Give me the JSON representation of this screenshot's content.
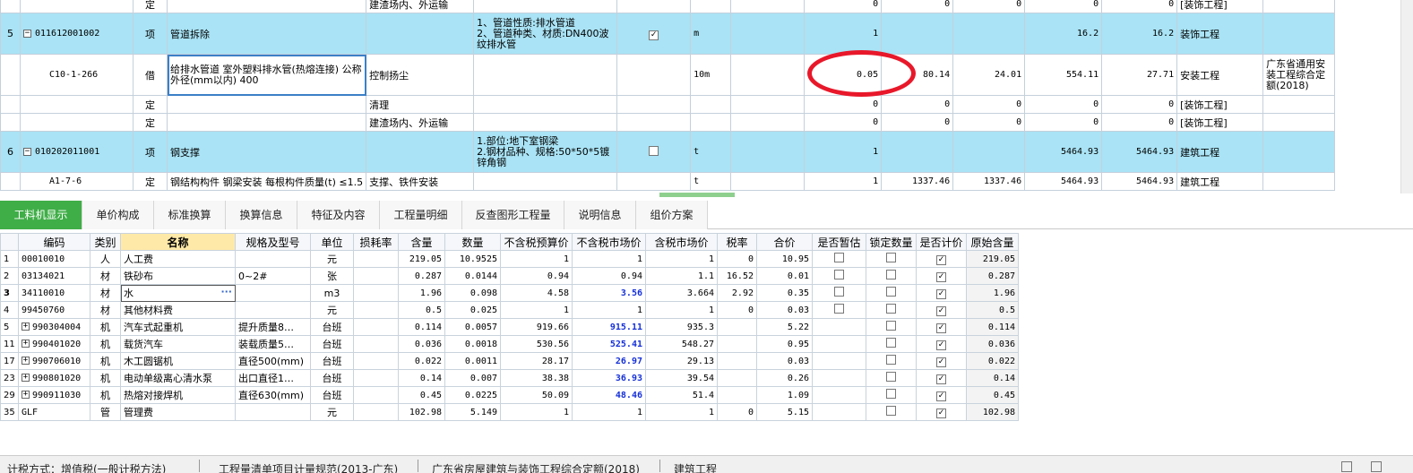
{
  "top_rows": [
    {
      "type": "child",
      "no": "",
      "code": "",
      "kind": "定",
      "name": "",
      "desc": "建渣场内、外运输",
      "feature": "",
      "check": "",
      "unit": "",
      "v1": "0",
      "v2": "0",
      "v3": "0",
      "v4": "0",
      "v5": "0",
      "cat": "[装饰工程]",
      "std": ""
    },
    {
      "type": "blue",
      "no": "5",
      "code": "011612001002",
      "kind": "项",
      "name": "管道拆除",
      "desc": "",
      "feature": "1、管道性质:排水管道\n2、管道种类、材质:DN400波纹排水管",
      "check": "checked",
      "unit": "m",
      "v1": "1",
      "v2": "",
      "v3": "",
      "v4": "16.2",
      "v5": "16.2",
      "cat": "装饰工程",
      "std": ""
    },
    {
      "type": "tall",
      "no": "",
      "code": "C10-1-266",
      "kind": "借",
      "name": "给排水管道 室外塑料排水管(热熔连接) 公称外径(mm以内) 400",
      "desc": "控制扬尘",
      "feature": "",
      "check": "",
      "unit": "10m",
      "v1": "0.05",
      "v2": "80.14",
      "v3": "24.01",
      "v4": "554.11",
      "v5": "27.71",
      "cat": "安装工程",
      "std": "广东省通用安装工程综合定额(2018)"
    },
    {
      "type": "child",
      "no": "",
      "code": "",
      "kind": "定",
      "name": "",
      "desc": "清理",
      "feature": "",
      "check": "",
      "unit": "",
      "v1": "0",
      "v2": "0",
      "v3": "0",
      "v4": "0",
      "v5": "0",
      "cat": "[装饰工程]",
      "std": ""
    },
    {
      "type": "child",
      "no": "",
      "code": "",
      "kind": "定",
      "name": "",
      "desc": "建渣场内、外运输",
      "feature": "",
      "check": "",
      "unit": "",
      "v1": "0",
      "v2": "0",
      "v3": "0",
      "v4": "0",
      "v5": "0",
      "cat": "[装饰工程]",
      "std": ""
    },
    {
      "type": "blue",
      "no": "6",
      "code": "010202011001",
      "kind": "项",
      "name": "钢支撑",
      "desc": "",
      "feature": "1.部位:地下室钢梁\n2.钢材品种、规格:50*50*5镀锌角钢",
      "check": "unchecked",
      "unit": "t",
      "v1": "1",
      "v2": "",
      "v3": "",
      "v4": "5464.93",
      "v5": "5464.93",
      "cat": "建筑工程",
      "std": ""
    },
    {
      "type": "child",
      "no": "",
      "code": "A1-7-6",
      "kind": "定",
      "name": "钢结构构件 钢梁安装 每根构件质量(t) ≤1.5",
      "desc": "支撑、铁件安装",
      "feature": "",
      "check": "",
      "unit": "t",
      "v1": "1",
      "v2": "1337.46",
      "v3": "1337.46",
      "v4": "5464.93",
      "v5": "5464.93",
      "cat": "建筑工程",
      "std": ""
    }
  ],
  "tabs": [
    "工料机显示",
    "单价构成",
    "标准换算",
    "换算信息",
    "特征及内容",
    "工程量明细",
    "反查图形工程量",
    "说明信息",
    "组价方案"
  ],
  "grid_headers": [
    "编码",
    "类别",
    "名称",
    "规格及型号",
    "单位",
    "损耗率",
    "含量",
    "数量",
    "不含税预算价",
    "不含税市场价",
    "含税市场价",
    "税率",
    "合价",
    "是否暂估",
    "锁定数量",
    "是否计价",
    "原始含量"
  ],
  "grid_rows": [
    {
      "no": "1",
      "code": "00010010",
      "type": "人",
      "name": "人工费",
      "spec": "",
      "unit": "元",
      "loss": "",
      "qty_ratio": "219.05",
      "qty": "10.9525",
      "pre_tax_budget": "1",
      "pre_tax_market": "1",
      "tax_market": "1",
      "tax_rate": "0",
      "total": "10.95",
      "est": "unchecked",
      "lock": "unchecked",
      "priced": "checked",
      "orig": "219.05",
      "expand": false,
      "blue": false
    },
    {
      "no": "2",
      "code": "03134021",
      "type": "材",
      "name": "铁砂布",
      "spec": "0~2#",
      "unit": "张",
      "loss": "",
      "qty_ratio": "0.287",
      "qty": "0.0144",
      "pre_tax_budget": "0.94",
      "pre_tax_market": "0.94",
      "tax_market": "1.1",
      "tax_rate": "16.52",
      "total": "0.01",
      "est": "unchecked",
      "lock": "unchecked",
      "priced": "checked",
      "orig": "0.287",
      "expand": false,
      "blue": false
    },
    {
      "no": "3",
      "code": "34110010",
      "type": "材",
      "name": "水",
      "spec": "",
      "unit": "m3",
      "loss": "",
      "qty_ratio": "1.96",
      "qty": "0.098",
      "pre_tax_budget": "4.58",
      "pre_tax_market": "3.56",
      "tax_market": "3.664",
      "tax_rate": "2.92",
      "total": "0.35",
      "est": "unchecked",
      "lock": "unchecked",
      "priced": "checked",
      "orig": "1.96",
      "expand": false,
      "blue": true,
      "selected": true
    },
    {
      "no": "4",
      "code": "99450760",
      "type": "材",
      "name": "其他材料费",
      "spec": "",
      "unit": "元",
      "loss": "",
      "qty_ratio": "0.5",
      "qty": "0.025",
      "pre_tax_budget": "1",
      "pre_tax_market": "1",
      "tax_market": "1",
      "tax_rate": "0",
      "total": "0.03",
      "est": "unchecked",
      "lock": "unchecked",
      "priced": "checked",
      "orig": "0.5",
      "expand": false,
      "blue": false
    },
    {
      "no": "5",
      "code": "990304004",
      "type": "机",
      "name": "汽车式起重机",
      "spec": "提升质量8…",
      "unit": "台班",
      "loss": "",
      "qty_ratio": "0.114",
      "qty": "0.0057",
      "pre_tax_budget": "919.66",
      "pre_tax_market": "915.11",
      "tax_market": "935.3",
      "tax_rate": "",
      "total": "5.22",
      "est": "",
      "lock": "unchecked",
      "priced": "checked",
      "orig": "0.114",
      "expand": true,
      "blue": true
    },
    {
      "no": "11",
      "code": "990401020",
      "type": "机",
      "name": "载货汽车",
      "spec": "装载质量5…",
      "unit": "台班",
      "loss": "",
      "qty_ratio": "0.036",
      "qty": "0.0018",
      "pre_tax_budget": "530.56",
      "pre_tax_market": "525.41",
      "tax_market": "548.27",
      "tax_rate": "",
      "total": "0.95",
      "est": "",
      "lock": "unchecked",
      "priced": "checked",
      "orig": "0.036",
      "expand": true,
      "blue": true
    },
    {
      "no": "17",
      "code": "990706010",
      "type": "机",
      "name": "木工圆锯机",
      "spec": "直径500(mm)",
      "unit": "台班",
      "loss": "",
      "qty_ratio": "0.022",
      "qty": "0.0011",
      "pre_tax_budget": "28.17",
      "pre_tax_market": "26.97",
      "tax_market": "29.13",
      "tax_rate": "",
      "total": "0.03",
      "est": "",
      "lock": "unchecked",
      "priced": "checked",
      "orig": "0.022",
      "expand": true,
      "blue": true
    },
    {
      "no": "23",
      "code": "990801020",
      "type": "机",
      "name": "电动单级离心清水泵",
      "spec": "出口直径1…",
      "unit": "台班",
      "loss": "",
      "qty_ratio": "0.14",
      "qty": "0.007",
      "pre_tax_budget": "38.38",
      "pre_tax_market": "36.93",
      "tax_market": "39.54",
      "tax_rate": "",
      "total": "0.26",
      "est": "",
      "lock": "unchecked",
      "priced": "checked",
      "orig": "0.14",
      "expand": true,
      "blue": true
    },
    {
      "no": "29",
      "code": "990911030",
      "type": "机",
      "name": "热熔对接焊机",
      "spec": "直径630(mm)",
      "unit": "台班",
      "loss": "",
      "qty_ratio": "0.45",
      "qty": "0.0225",
      "pre_tax_budget": "50.09",
      "pre_tax_market": "48.46",
      "tax_market": "51.4",
      "tax_rate": "",
      "total": "1.09",
      "est": "",
      "lock": "unchecked",
      "priced": "checked",
      "orig": "0.45",
      "expand": true,
      "blue": true
    },
    {
      "no": "35",
      "code": "GLF",
      "type": "管",
      "name": "管理费",
      "spec": "",
      "unit": "元",
      "loss": "",
      "qty_ratio": "102.98",
      "qty": "5.149",
      "pre_tax_budget": "1",
      "pre_tax_market": "1",
      "tax_market": "1",
      "tax_rate": "0",
      "total": "5.15",
      "est": "",
      "lock": "unchecked",
      "priced": "checked",
      "orig": "102.98",
      "expand": false,
      "blue": false
    }
  ],
  "status": {
    "item1": "计税方式：增值税(一般计税方法)",
    "item2": "工程量清单项目计量规范(2013-广东)",
    "item3": "广东省房屋建筑与装饰工程综合定额(2018)",
    "item4": "建筑工程"
  },
  "colors": {
    "accent": "#3fae47",
    "row_highlight": "#a9e3f5",
    "annotation": "#e8182a",
    "market_price": "#1530d8"
  }
}
